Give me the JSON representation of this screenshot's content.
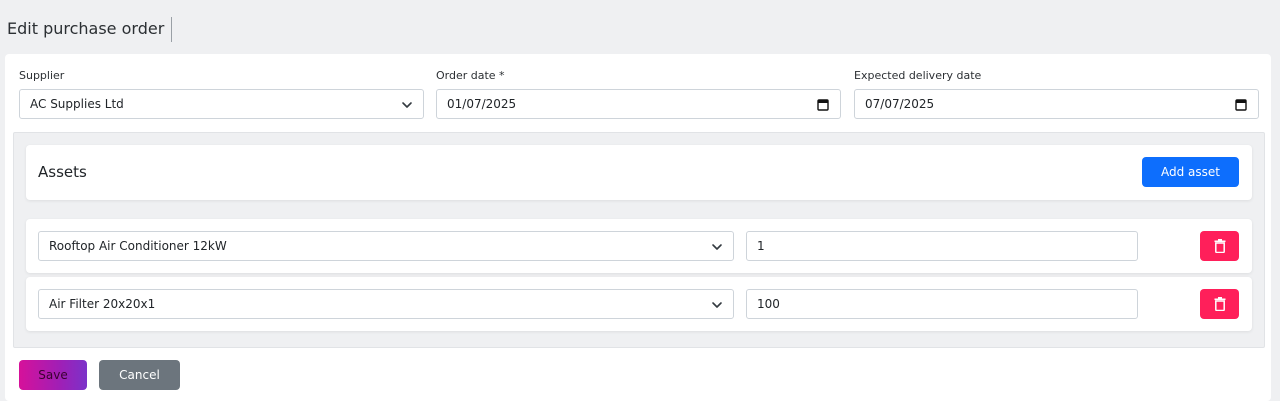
{
  "header": {
    "title": "Edit purchase order"
  },
  "form": {
    "supplier": {
      "label": "Supplier",
      "value": "AC Supplies Ltd",
      "icon": "chevron-down-icon"
    },
    "order_date": {
      "label": "Order date *",
      "value": "01/07/2025",
      "icon": "calendar-icon"
    },
    "delivery_date": {
      "label": "Expected delivery date",
      "value": "07/07/2025",
      "icon": "calendar-icon"
    }
  },
  "assets": {
    "title": "Assets",
    "add_label": "Add asset",
    "rows": [
      {
        "asset": "Rooftop Air Conditioner 12kW",
        "quantity": "1",
        "delete_icon": "trash-icon"
      },
      {
        "asset": "Air Filter 20x20x1",
        "quantity": "100",
        "delete_icon": "trash-icon"
      }
    ]
  },
  "actions": {
    "save_label": "Save",
    "cancel_label": "Cancel"
  },
  "colors": {
    "primary": "#0d6efd",
    "danger": "#ff1f5a",
    "save_gradient_start": "#d6119a",
    "save_gradient_end": "#7b32c9",
    "secondary": "#6c757d",
    "page_bg": "#eff0f2"
  }
}
